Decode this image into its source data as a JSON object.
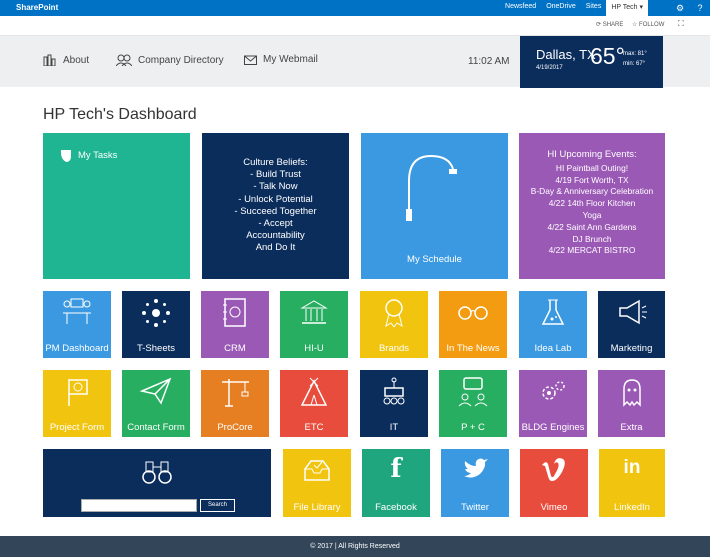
{
  "suitebar": {
    "brand": "SharePoint",
    "links": [
      "Newsfeed",
      "OneDrive",
      "Sites"
    ],
    "user": "HP Tech ▾",
    "icons": [
      "gear-icon",
      "help-icon"
    ]
  },
  "sharebar": {
    "share": "SHARE",
    "follow": "FOLLOW"
  },
  "nav": {
    "about": "About",
    "directory": "Company Directory",
    "webmail": "My Webmail",
    "time": "11:02 AM"
  },
  "weather": {
    "city": "Dallas, TX",
    "date": "4/19/2017",
    "temp": "65°",
    "max": "max: 81°",
    "min": "min: 67°"
  },
  "page_title": "HP Tech's Dashboard",
  "big_tiles": {
    "tasks": "My Tasks",
    "culture": [
      "Culture Beliefs:",
      "- Build Trust",
      "- Talk Now",
      "- Unlock Potential",
      "- Succeed Together",
      "- Accept",
      "Accountability",
      "And Do It"
    ],
    "schedule": "My Schedule",
    "events": [
      "HI Upcoming Events:",
      "HI Paintball Outing!",
      "4/19 Fort Worth, TX",
      "B-Day & Anniversary Celebration",
      "4/22 14th Floor Kitchen",
      "Yoga",
      "4/22 Saint Ann Gardens",
      "DJ Brunch",
      "4/22 MERCAT BISTRO"
    ]
  },
  "tiles": {
    "row1": [
      "PM Dashboard",
      "T-Sheets",
      "CRM",
      "HI-U",
      "Brands",
      "In The News",
      "Idea Lab",
      "Marketing"
    ],
    "row2": [
      "Project Form",
      "Contact Form",
      "ProCore",
      "ETC",
      "IT",
      "P + C",
      "BLDG Engines",
      "Extra"
    ],
    "row3": [
      "File Library",
      "Facebook",
      "Twitter",
      "Vimeo",
      "LinkedIn"
    ]
  },
  "search": {
    "button": "Search",
    "placeholder": ""
  },
  "footer": "© 2017 | All Rights Reserved",
  "colors": {
    "teal": "#20b592",
    "navy": "#0b2d5c",
    "blue": "#3a99e0",
    "purple": "#9b59b6",
    "green": "#27ae60",
    "yellow": "#f1c40f",
    "orange": "#f39c12",
    "red": "#e74c3c",
    "dark_orange": "#e67e22",
    "footer": "#334659"
  }
}
